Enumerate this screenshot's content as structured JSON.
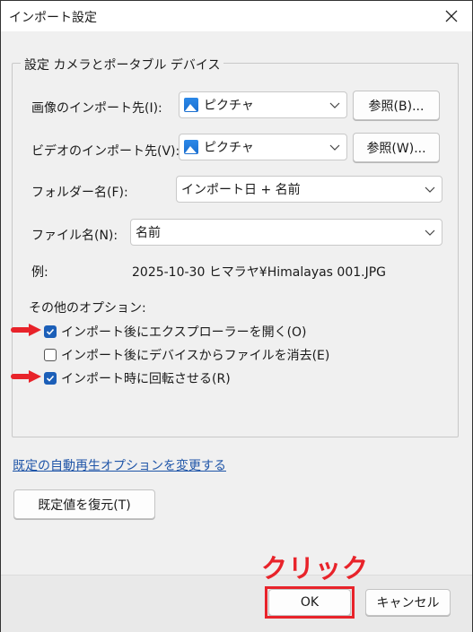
{
  "window": {
    "title": "インポート設定"
  },
  "group": {
    "legend": "設定 カメラとポータブル デバイス"
  },
  "fields": {
    "image_dest_label": "画像のインポート先(I):",
    "image_dest_value": "ピクチャ",
    "image_browse": "参照(B)...",
    "video_dest_label": "ビデオのインポート先(V):",
    "video_dest_value": "ピクチャ",
    "video_browse": "参照(W)...",
    "folder_name_label": "フォルダー名(F):",
    "folder_name_value": "インポート日 + 名前",
    "file_name_label": "ファイル名(N):",
    "file_name_value": "名前",
    "example_label": "例:",
    "example_value": "2025-10-30 ヒマラヤ¥Himalayas 001.JPG"
  },
  "options": {
    "heading": "その他のオプション:",
    "items": [
      {
        "label": "インポート後にエクスプローラーを開く(O)",
        "checked": true
      },
      {
        "label": "インポート後にデバイスからファイルを消去(E)",
        "checked": false
      },
      {
        "label": "インポート時に回転させる(R)",
        "checked": true
      }
    ]
  },
  "links": {
    "autoplay": "既定の自動再生オプションを変更する"
  },
  "buttons": {
    "restore": "既定値を復元(T)",
    "ok": "OK",
    "cancel": "キャンセル"
  },
  "annotation": {
    "text": "クリック",
    "color": "#e8232a"
  },
  "colors": {
    "accent": "#1c5fb8",
    "link": "#1f55a8",
    "annotation": "#e8232a"
  }
}
